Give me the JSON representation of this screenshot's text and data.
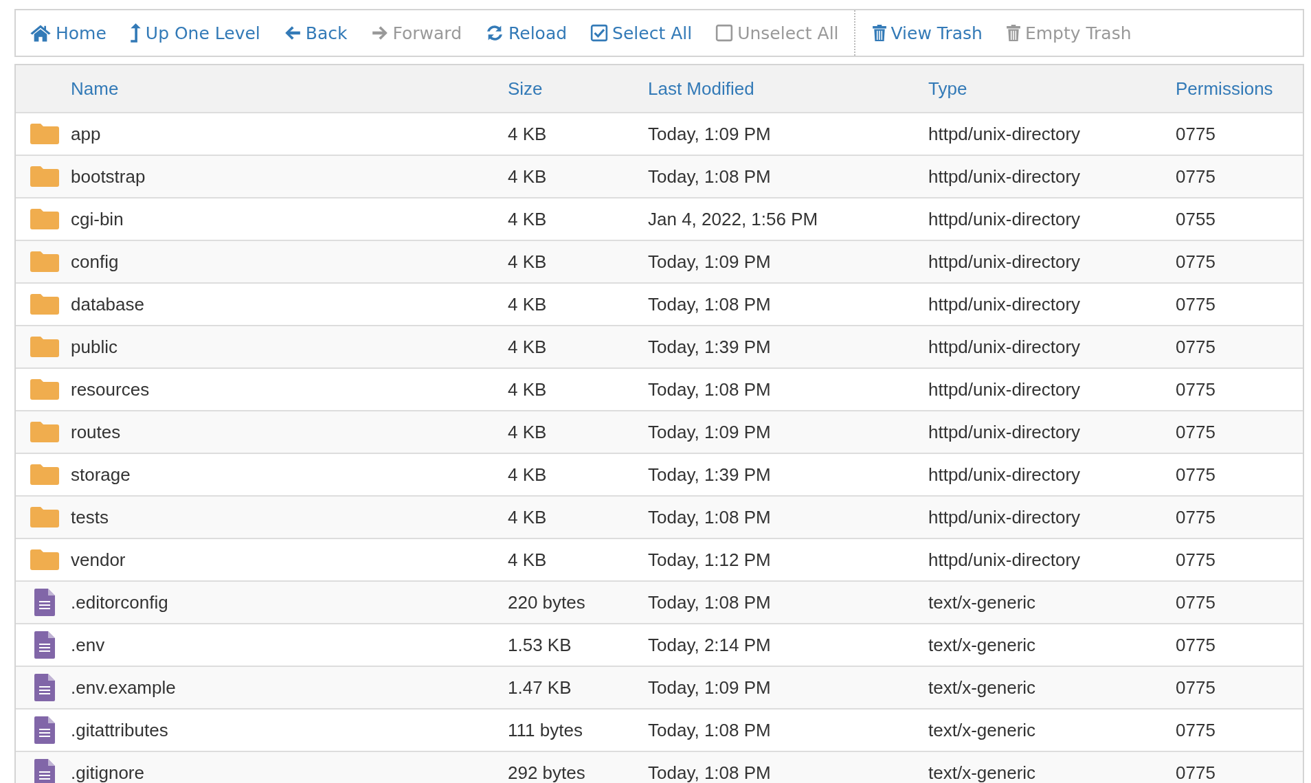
{
  "toolbar": {
    "groups": [
      {
        "items": [
          {
            "kind": "home",
            "label": "Home",
            "disabled": false
          },
          {
            "kind": "up",
            "label": "Up One Level",
            "disabled": false
          },
          {
            "kind": "back",
            "label": "Back",
            "disabled": false
          },
          {
            "kind": "forward",
            "label": "Forward",
            "disabled": true
          },
          {
            "kind": "reload",
            "label": "Reload",
            "disabled": false
          },
          {
            "kind": "check",
            "label": "Select All",
            "disabled": false
          },
          {
            "kind": "uncheck",
            "label": "Unselect All",
            "disabled": true
          }
        ]
      },
      {
        "items": [
          {
            "kind": "trash",
            "label": "View Trash",
            "disabled": false
          },
          {
            "kind": "trash",
            "label": "Empty Trash",
            "disabled": true
          }
        ]
      }
    ]
  },
  "table": {
    "columns": [
      "Name",
      "Size",
      "Last Modified",
      "Type",
      "Permissions"
    ],
    "rows": [
      {
        "kind": "folder",
        "name": "app",
        "size": "4 KB",
        "modified": "Today, 1:09 PM",
        "type": "httpd/unix-directory",
        "permissions": "0775"
      },
      {
        "kind": "folder",
        "name": "bootstrap",
        "size": "4 KB",
        "modified": "Today, 1:08 PM",
        "type": "httpd/unix-directory",
        "permissions": "0775"
      },
      {
        "kind": "folder",
        "name": "cgi-bin",
        "size": "4 KB",
        "modified": "Jan 4, 2022, 1:56 PM",
        "type": "httpd/unix-directory",
        "permissions": "0755"
      },
      {
        "kind": "folder",
        "name": "config",
        "size": "4 KB",
        "modified": "Today, 1:09 PM",
        "type": "httpd/unix-directory",
        "permissions": "0775"
      },
      {
        "kind": "folder",
        "name": "database",
        "size": "4 KB",
        "modified": "Today, 1:08 PM",
        "type": "httpd/unix-directory",
        "permissions": "0775"
      },
      {
        "kind": "folder",
        "name": "public",
        "size": "4 KB",
        "modified": "Today, 1:39 PM",
        "type": "httpd/unix-directory",
        "permissions": "0775"
      },
      {
        "kind": "folder",
        "name": "resources",
        "size": "4 KB",
        "modified": "Today, 1:08 PM",
        "type": "httpd/unix-directory",
        "permissions": "0775"
      },
      {
        "kind": "folder",
        "name": "routes",
        "size": "4 KB",
        "modified": "Today, 1:09 PM",
        "type": "httpd/unix-directory",
        "permissions": "0775"
      },
      {
        "kind": "folder",
        "name": "storage",
        "size": "4 KB",
        "modified": "Today, 1:39 PM",
        "type": "httpd/unix-directory",
        "permissions": "0775"
      },
      {
        "kind": "folder",
        "name": "tests",
        "size": "4 KB",
        "modified": "Today, 1:08 PM",
        "type": "httpd/unix-directory",
        "permissions": "0775"
      },
      {
        "kind": "folder",
        "name": "vendor",
        "size": "4 KB",
        "modified": "Today, 1:12 PM",
        "type": "httpd/unix-directory",
        "permissions": "0775"
      },
      {
        "kind": "file",
        "name": ".editorconfig",
        "size": "220 bytes",
        "modified": "Today, 1:08 PM",
        "type": "text/x-generic",
        "permissions": "0775"
      },
      {
        "kind": "file",
        "name": ".env",
        "size": "1.53 KB",
        "modified": "Today, 2:14 PM",
        "type": "text/x-generic",
        "permissions": "0775"
      },
      {
        "kind": "file",
        "name": ".env.example",
        "size": "1.47 KB",
        "modified": "Today, 1:09 PM",
        "type": "text/x-generic",
        "permissions": "0775"
      },
      {
        "kind": "file",
        "name": ".gitattributes",
        "size": "111 bytes",
        "modified": "Today, 1:08 PM",
        "type": "text/x-generic",
        "permissions": "0775"
      },
      {
        "kind": "file",
        "name": ".gitignore",
        "size": "292 bytes",
        "modified": "Today, 1:08 PM",
        "type": "text/x-generic",
        "permissions": "0775"
      }
    ]
  }
}
